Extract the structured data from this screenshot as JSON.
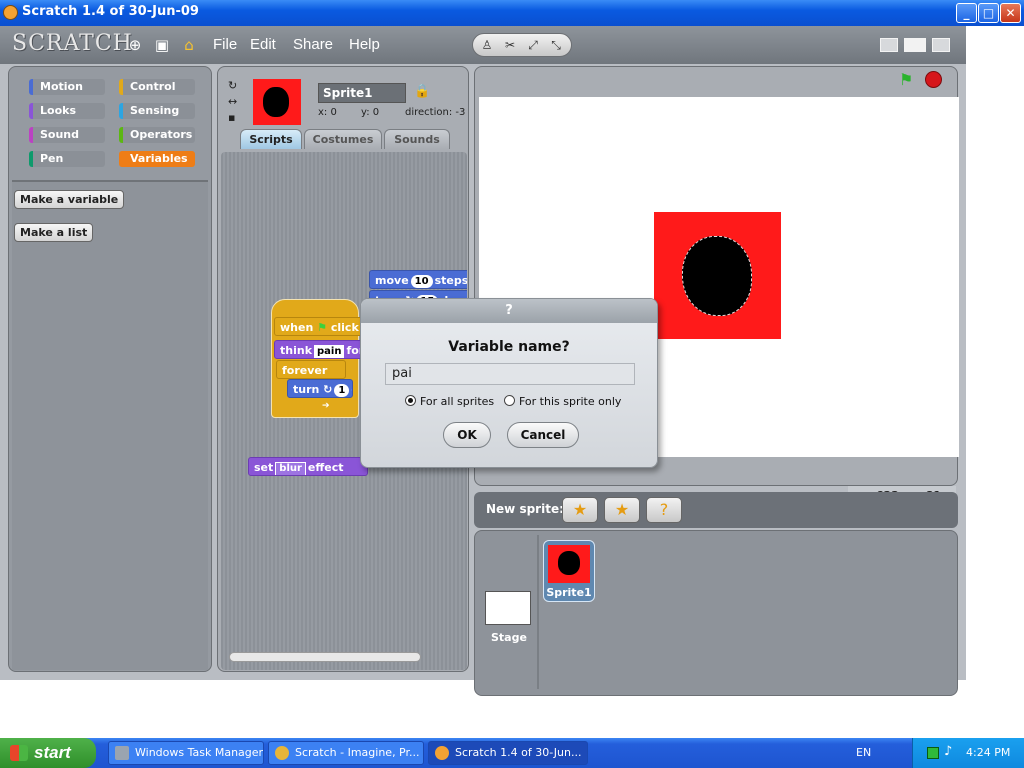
{
  "window": {
    "title": "Scratch 1.4 of 30-Jun-09"
  },
  "app": {
    "logo": "SCRATCH",
    "menus": [
      "File",
      "Edit",
      "Share",
      "Help"
    ]
  },
  "palette": {
    "categories": [
      {
        "label": "Motion",
        "color": "#4a6cd4"
      },
      {
        "label": "Control",
        "color": "#e1a91a"
      },
      {
        "label": "Looks",
        "color": "#8a55d7"
      },
      {
        "label": "Sensing",
        "color": "#2ca5e2"
      },
      {
        "label": "Sound",
        "color": "#bb42c3"
      },
      {
        "label": "Operators",
        "color": "#5cb712"
      },
      {
        "label": "Pen",
        "color": "#0e9a6c"
      },
      {
        "label": "Variables",
        "color": "#ee7d16"
      }
    ],
    "active_category": "Variables",
    "buttons": {
      "make_variable": "Make a variable",
      "make_list": "Make a list"
    }
  },
  "sprite_info": {
    "name": "Sprite1",
    "x_label": "x: 0",
    "y_label": "y: 0",
    "direction_label": "direction: -3"
  },
  "tabs": [
    "Scripts",
    "Costumes",
    "Sounds"
  ],
  "active_tab": "Scripts",
  "blocks": {
    "move": {
      "pre": "move",
      "value": "10",
      "post": "steps"
    },
    "turn_top": {
      "pre": "turn ↻",
      "value": "15",
      "post": "degr"
    },
    "when_flag": {
      "pre": "when",
      "post": "click"
    },
    "think": {
      "pre": "think",
      "value": "pain",
      "post": "for"
    },
    "forever": {
      "label": "forever"
    },
    "turn_inner": {
      "pre": "turn ↻",
      "value": "1",
      "post": "d"
    },
    "set_effect": {
      "pre": "set",
      "value": "blur",
      "post": "effect"
    }
  },
  "stage": {
    "coords_x": "x: -622",
    "coords_y": "y: 81"
  },
  "new_sprite": {
    "label": "New sprite:"
  },
  "sprite_list": {
    "stage_label": "Stage",
    "sprites": [
      {
        "name": "Sprite1"
      }
    ]
  },
  "dialog": {
    "title": "?",
    "prompt": "Variable name?",
    "input_value": "pai",
    "radio_all": "For all sprites",
    "radio_this": "For this sprite only",
    "selected": "For all sprites",
    "ok": "OK",
    "cancel": "Cancel"
  },
  "taskbar": {
    "start": "start",
    "tasks": [
      {
        "label": "Windows Task Manager",
        "active": false
      },
      {
        "label": "Scratch - Imagine, Pr...",
        "active": false
      },
      {
        "label": "Scratch 1.4 of 30-Jun...",
        "active": true
      }
    ],
    "language": "EN",
    "clock": "4:24 PM"
  }
}
